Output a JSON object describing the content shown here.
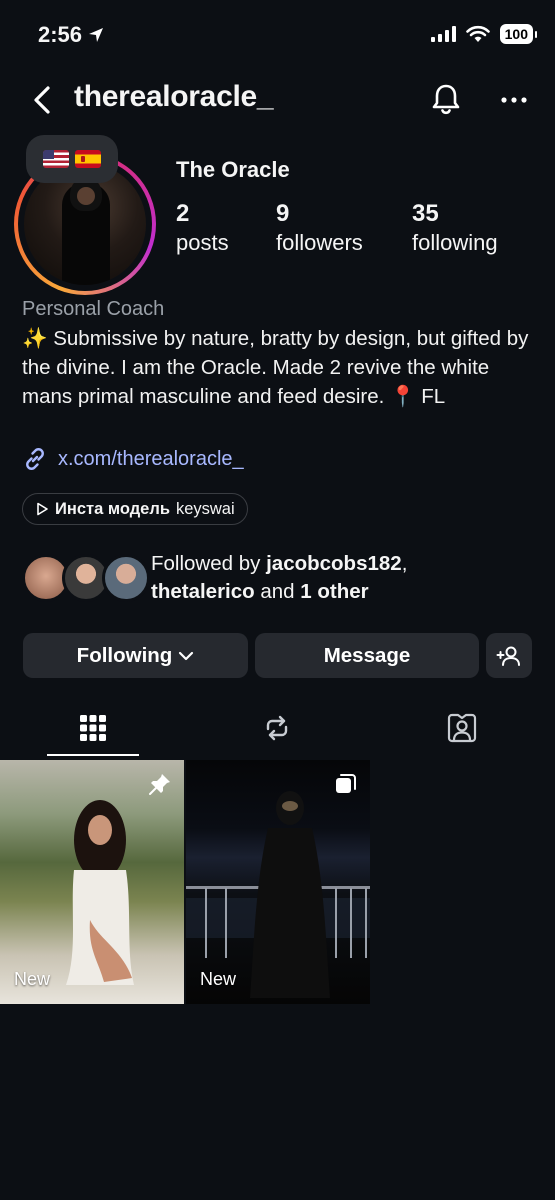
{
  "status_bar": {
    "time": "2:56",
    "battery": "100"
  },
  "header": {
    "username": "therealoracle_"
  },
  "profile": {
    "display_name": "The Oracle",
    "stats": [
      {
        "value": "2",
        "label": "posts"
      },
      {
        "value": "9",
        "label": "followers"
      },
      {
        "value": "35",
        "label": "following"
      }
    ],
    "category": "Personal Coach",
    "bio": "✨ Submissive by nature, bratty by design, but gifted by the divine. I am the Oracle. Made 2 revive the white mans primal masculine and feed desire. 📍 FL",
    "link": "x.com/therealoracle_",
    "thread_pill": {
      "bold": "Инста модель",
      "handle": "keyswai"
    },
    "followed_by": {
      "prefix": "Followed by ",
      "user1": "jacobcobs182",
      "separator": ",",
      "user2": "thetalerico",
      "joiner": " and ",
      "others": "1 other"
    }
  },
  "buttons": {
    "following": "Following",
    "message": "Message"
  },
  "posts": [
    {
      "label": "New"
    },
    {
      "label": "New"
    }
  ]
}
